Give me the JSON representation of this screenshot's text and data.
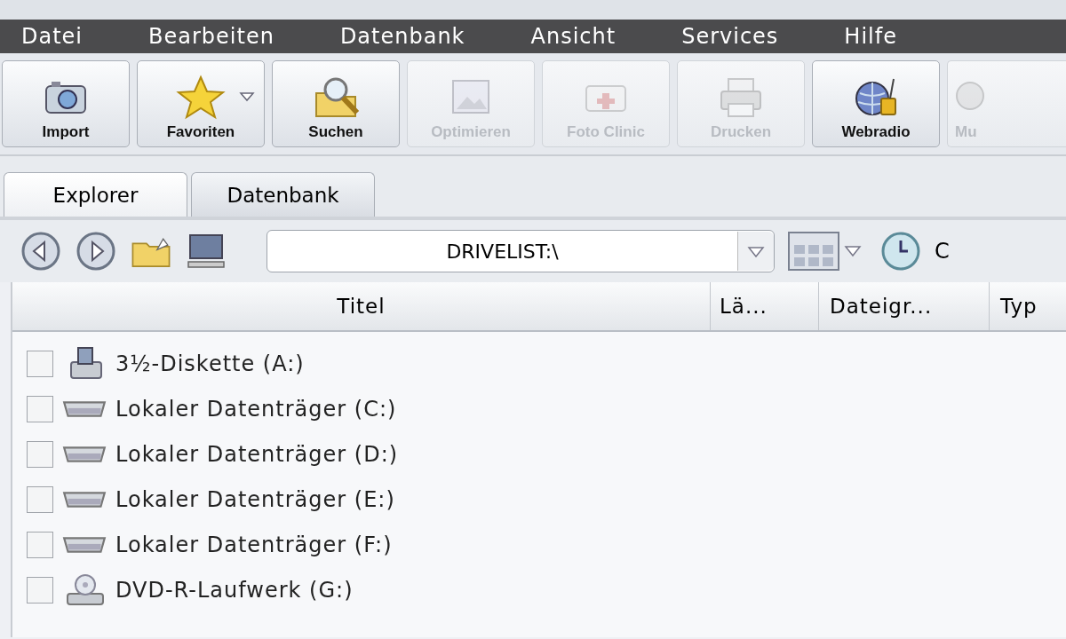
{
  "menu_bar": [
    "Datei",
    "Bearbeiten",
    "Datenbank",
    "Ansicht",
    "Services",
    "Hilfe"
  ],
  "toolbar": [
    {
      "label": "Import",
      "kind": "camera",
      "disabled": false,
      "dropdown": false
    },
    {
      "label": "Favoriten",
      "kind": "star",
      "disabled": false,
      "dropdown": true
    },
    {
      "label": "Suchen",
      "kind": "search",
      "disabled": false,
      "dropdown": false
    },
    {
      "label": "Optimieren",
      "kind": "picture",
      "disabled": true,
      "dropdown": false
    },
    {
      "label": "Foto Clinic",
      "kind": "kit",
      "disabled": true,
      "dropdown": false
    },
    {
      "label": "Drucken",
      "kind": "printer",
      "disabled": true,
      "dropdown": false
    },
    {
      "label": "Webradio",
      "kind": "globe",
      "disabled": false,
      "dropdown": false
    },
    {
      "label": "Mu",
      "kind": "music",
      "disabled": true,
      "dropdown": false
    }
  ],
  "tabs": [
    {
      "label": "Explorer",
      "selected": true
    },
    {
      "label": "Datenbank",
      "selected": false
    }
  ],
  "address_bar": {
    "value": "DRIVELIST:\\",
    "cut_label": "C"
  },
  "table": {
    "columns": [
      "Titel",
      "Lä...",
      "Dateigr...",
      "Typ"
    ],
    "rows": [
      {
        "title": "3½-Diskette (A:)",
        "kind": "floppy",
        "checked": false
      },
      {
        "title": "Lokaler Datenträger (C:)",
        "kind": "drive",
        "checked": false
      },
      {
        "title": "Lokaler Datenträger (D:)",
        "kind": "drive",
        "checked": false
      },
      {
        "title": "Lokaler Datenträger (E:)",
        "kind": "drive",
        "checked": false
      },
      {
        "title": "Lokaler Datenträger (F:)",
        "kind": "drive",
        "checked": false
      },
      {
        "title": "DVD-R-Laufwerk (G:)",
        "kind": "dvd",
        "checked": false
      }
    ]
  }
}
